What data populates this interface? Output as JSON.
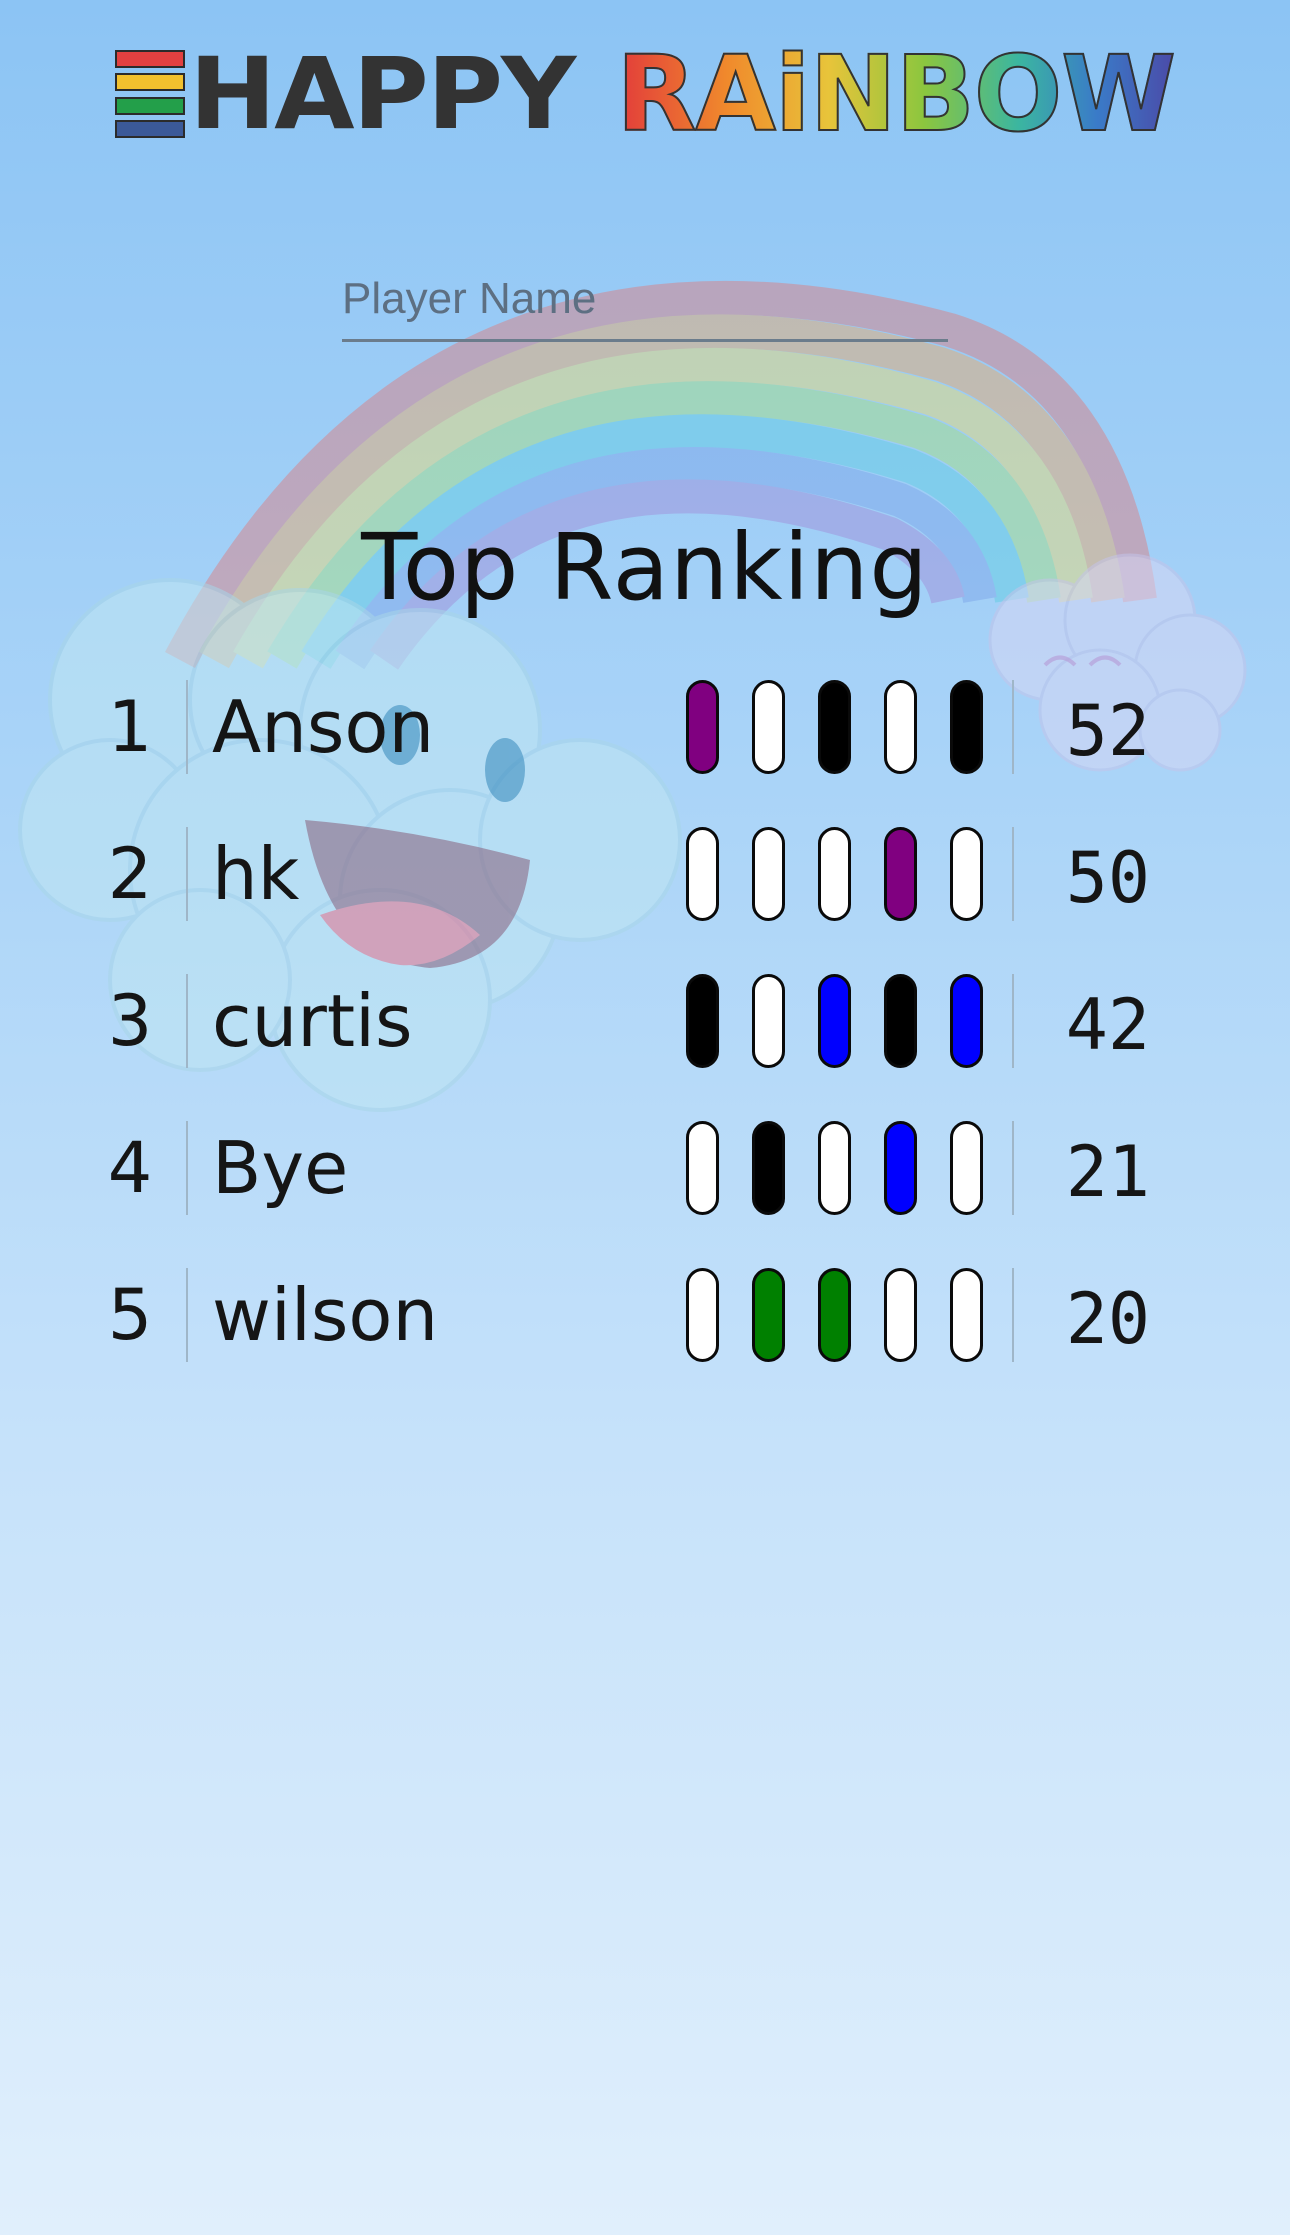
{
  "app": {
    "logo_word_1": "HAPPY",
    "logo_word_2": "RAiNBOW",
    "logo_stripe_colors": [
      "#e24040",
      "#f2c12e",
      "#239f4a",
      "#3b5998"
    ]
  },
  "name_input": {
    "placeholder": "Player Name",
    "value": ""
  },
  "ranking": {
    "title": "Top Ranking",
    "rows": [
      {
        "rank": "1",
        "name": "Anson",
        "score": "52",
        "pills": [
          "#800080",
          "#ffffff",
          "#000000",
          "#ffffff",
          "#000000"
        ]
      },
      {
        "rank": "2",
        "name": "hk",
        "score": "50",
        "pills": [
          "#ffffff",
          "#ffffff",
          "#ffffff",
          "#800080",
          "#ffffff"
        ]
      },
      {
        "rank": "3",
        "name": "curtis",
        "score": "42",
        "pills": [
          "#000000",
          "#ffffff",
          "#0000ff",
          "#000000",
          "#0000ff"
        ]
      },
      {
        "rank": "4",
        "name": "Bye",
        "score": "21",
        "pills": [
          "#ffffff",
          "#000000",
          "#ffffff",
          "#0000ff",
          "#ffffff"
        ]
      },
      {
        "rank": "5",
        "name": "wilson",
        "score": "20",
        "pills": [
          "#ffffff",
          "#008000",
          "#008000",
          "#ffffff",
          "#ffffff"
        ]
      }
    ]
  }
}
